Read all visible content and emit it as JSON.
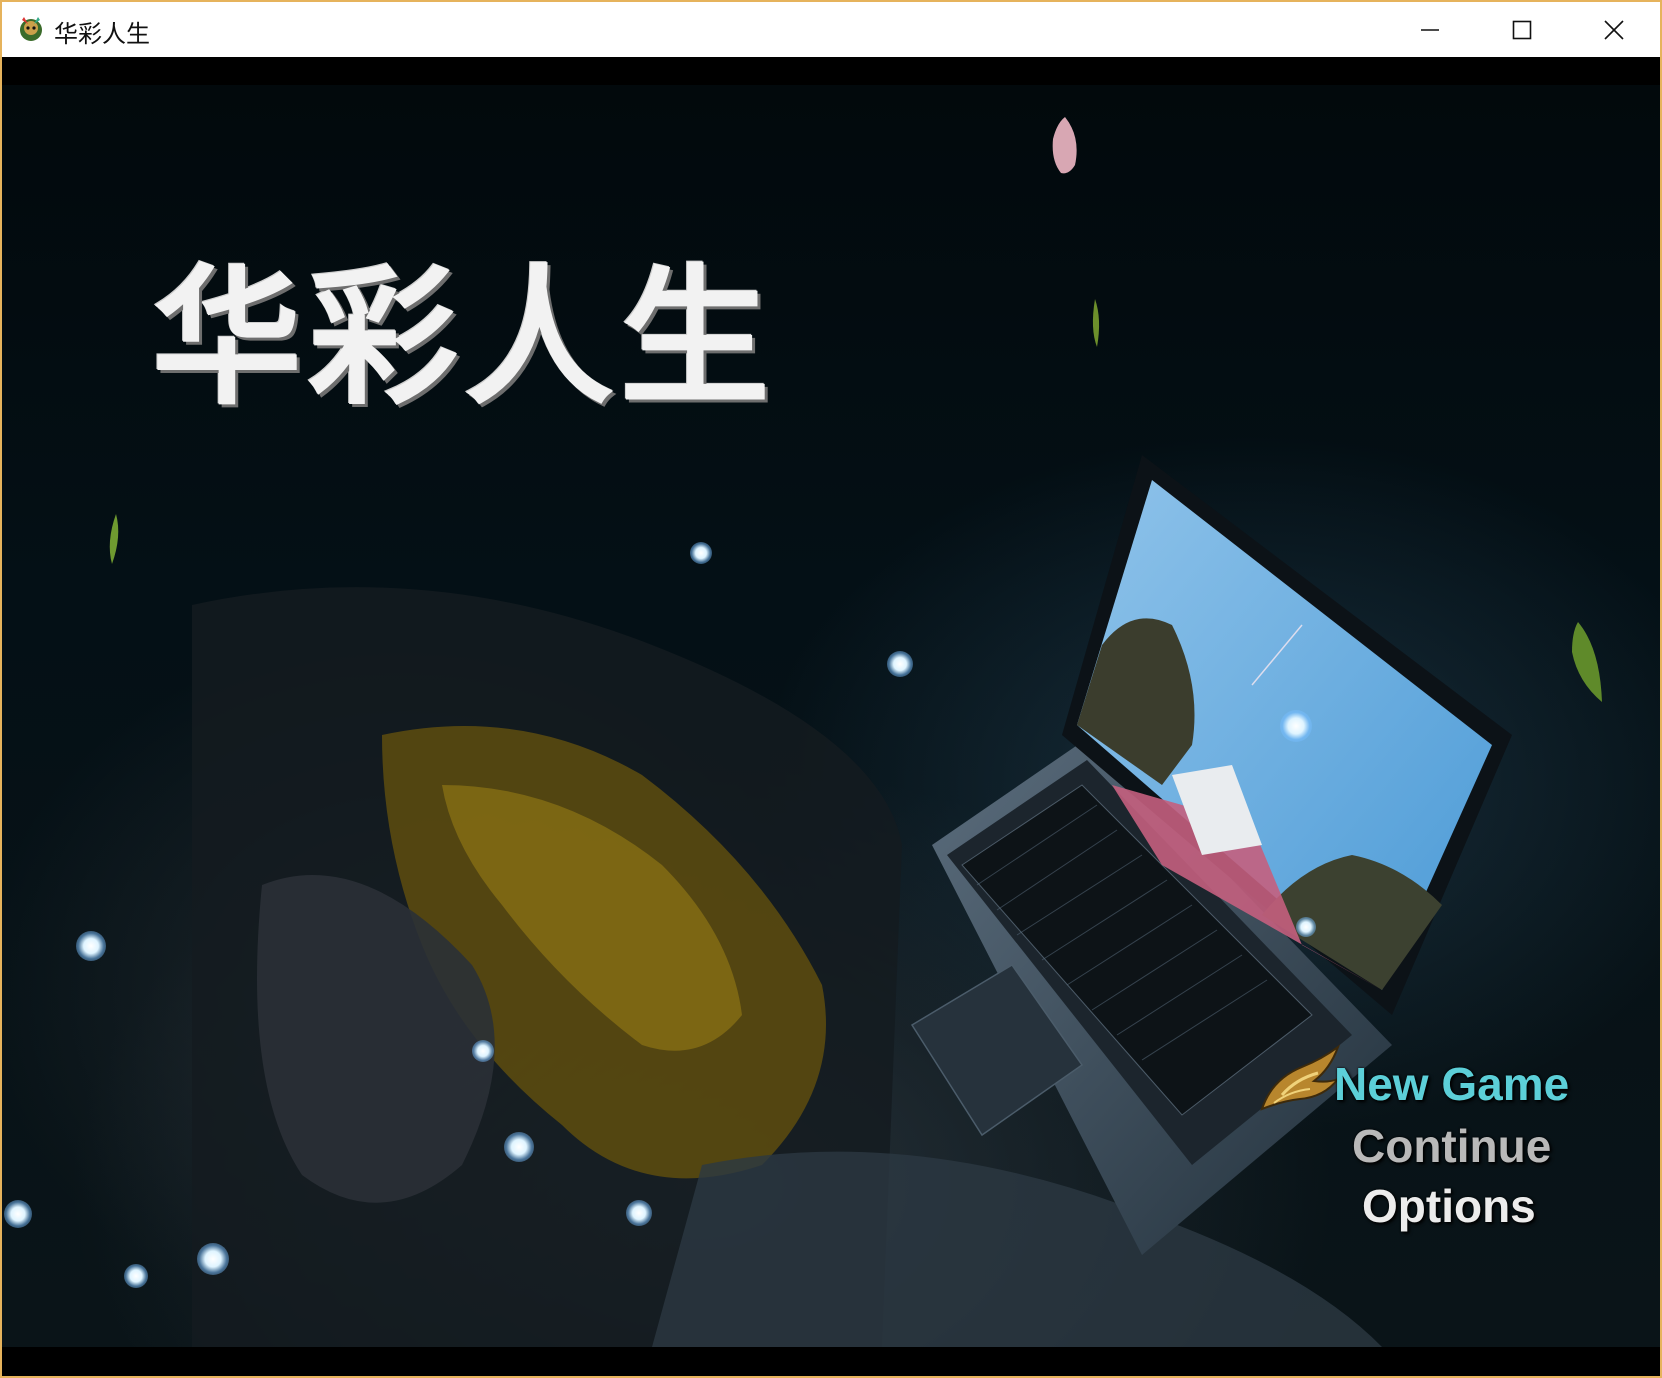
{
  "window": {
    "title": "华彩人生",
    "icon": "game-app-icon",
    "controls": [
      "minimize-icon",
      "maximize-icon",
      "close-icon"
    ]
  },
  "game": {
    "logo_text": "华彩人生",
    "menu": {
      "new_game": "New Game",
      "continue": "Continue",
      "options": "Options",
      "selected": "New Game"
    },
    "colors": {
      "selected": "#5ccfd8",
      "disabled": "#b9b9b9",
      "normal": "#ececec",
      "frame": "#e6b35c"
    }
  }
}
